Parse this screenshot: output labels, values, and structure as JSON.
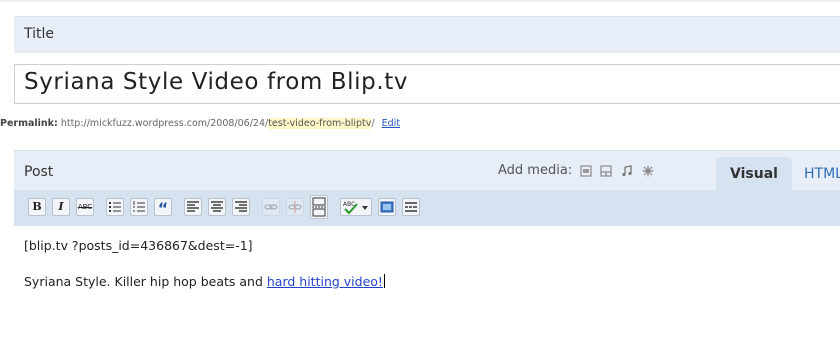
{
  "title_section": {
    "label": "Title",
    "value": "Syriana Style Video from Blip.tv"
  },
  "permalink": {
    "label": "Permalink:",
    "base_url": "http://mickfuzz.wordpress.com/2008/06/24/",
    "slug": "test-video-from-bliptv",
    "trailing": "/",
    "edit_label": "Edit"
  },
  "post_section": {
    "label": "Post",
    "add_media_label": "Add media:",
    "media_icons": [
      "image-icon",
      "video-icon",
      "audio-icon",
      "media-icon"
    ],
    "tabs": [
      {
        "label": "Visual",
        "active": true
      },
      {
        "label": "HTML",
        "active": false
      }
    ]
  },
  "toolbar": {
    "bold": "B",
    "italic": "I",
    "strike": "ABC",
    "blockquote": "“"
  },
  "editor": {
    "line1": "[blip.tv ?posts_id=436867&dest=-1]",
    "line2_text": "Syriana Style. Killer hip hop beats and ",
    "line2_link": "hard hitting video!"
  },
  "colors": {
    "header_bg": "#e8eef7",
    "toolbar_bg": "#d7e2f0",
    "link": "#2244cc",
    "slug_highlight": "#fff7c8"
  }
}
